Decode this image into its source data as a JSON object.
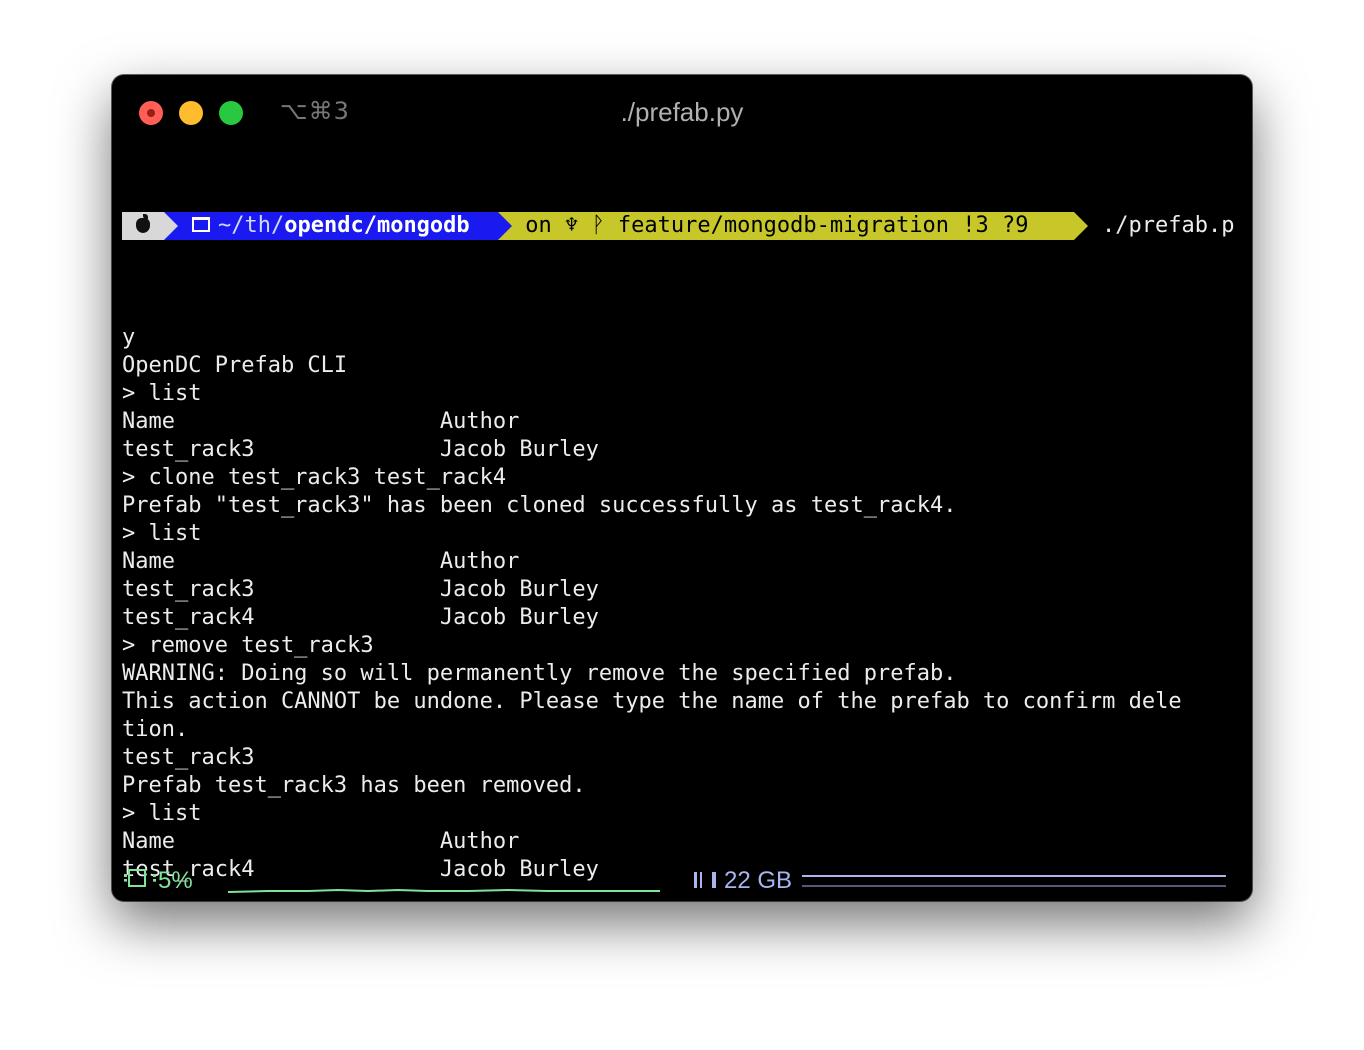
{
  "window": {
    "shortcut": "⌥⌘3",
    "title": "./prefab.py"
  },
  "prompt": {
    "dir_prefix": "~/th/",
    "dir_bold": "opendc/mongodb",
    "git_text": "on ♆ ᚹ feature/mongodb-migration !3 ?9",
    "command": "./prefab.p"
  },
  "terminal": {
    "lines": [
      "y",
      "OpenDC Prefab CLI",
      "> list",
      "Name                    Author",
      "test_rack3              Jacob Burley",
      "> clone test_rack3 test_rack4",
      "Prefab \"test_rack3\" has been cloned successfully as test_rack4.",
      "> list",
      "Name                    Author",
      "test_rack3              Jacob Burley",
      "test_rack4              Jacob Burley",
      "> remove test_rack3",
      "WARNING: Doing so will permanently remove the specified prefab.",
      "This action CANNOT be undone. Please type the name of the prefab to confirm dele",
      "tion.",
      "test_rack3",
      "Prefab test_rack3 has been removed.",
      "> list",
      "Name                    Author",
      "test_rack4              Jacob Burley"
    ],
    "input_prompt": "> "
  },
  "status": {
    "cpu": "5%",
    "memory": "22 GB"
  },
  "colors": {
    "dir_segment": "#1a1af0",
    "git_segment": "#c7c72a",
    "cpu": "#7fe39a",
    "memory": "#a9b4f0"
  }
}
